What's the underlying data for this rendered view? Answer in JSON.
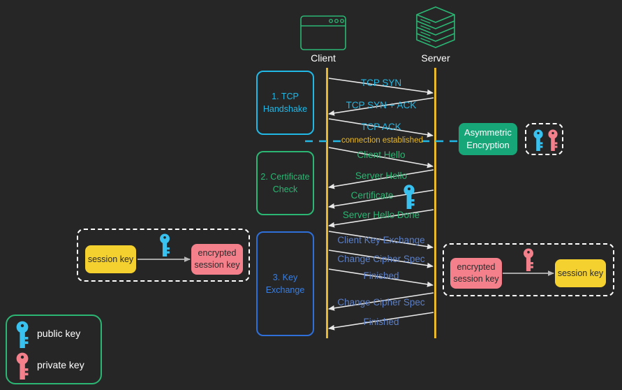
{
  "diagram": {
    "title": "TLS / SSL Handshake Sequence Diagram",
    "background_color": "#262626"
  },
  "actors": [
    {
      "name": "client",
      "label": "Client",
      "icon": "browser-window-icon"
    },
    {
      "name": "server",
      "label": "Server",
      "icon": "server-stack-icon"
    }
  ],
  "stages": [
    {
      "id": "stage-1",
      "label": "1. TCP\nHandshake",
      "line1": "1. TCP",
      "line2": "Handshake",
      "color": "#22B8E6"
    },
    {
      "id": "stage-2",
      "label": "2. Certificate\nCheck",
      "line1": "2. Certificate",
      "line2": "Check",
      "color": "#2BB673"
    },
    {
      "id": "stage-3",
      "label": "3. Key\nExchange",
      "line1": "3. Key",
      "line2": "Exchange",
      "color": "#3B7FE0"
    }
  ],
  "messages": [
    {
      "label": "TCP SYN",
      "direction": "client-to-server",
      "color": "#22B8E6"
    },
    {
      "label": "TCP SYN + ACK",
      "direction": "server-to-client",
      "color": "#22B8E6"
    },
    {
      "label": "TCP ACK",
      "direction": "client-to-server",
      "color": "#22B8E6"
    },
    {
      "label": "Client Hello",
      "direction": "client-to-server",
      "color": "#2BB673"
    },
    {
      "label": "Server Hello",
      "direction": "server-to-client",
      "color": "#2BB673"
    },
    {
      "label": "Certificate",
      "direction": "server-to-client",
      "color": "#2BB673",
      "badge": "public-key-icon"
    },
    {
      "label": "Server Hello Done",
      "direction": "server-to-client",
      "color": "#2BB673"
    },
    {
      "label": "Client Key Exchange",
      "direction": "client-to-server",
      "color": "#5B7FC7"
    },
    {
      "label": "Change Cipher Spec",
      "direction": "client-to-server",
      "color": "#5B7FC7"
    },
    {
      "label": "Finished",
      "direction": "client-to-server",
      "color": "#5B7FC7"
    },
    {
      "label": "Change Cipher Spec",
      "direction": "server-to-client",
      "color": "#5B7FC7"
    },
    {
      "label": "Finished",
      "direction": "server-to-client",
      "color": "#5B7FC7"
    }
  ],
  "separator": {
    "label": "connection established",
    "line_color": "#22B8E6",
    "text_color": "#E8B92C",
    "style": "dashed"
  },
  "asymmetric": {
    "label": "Asymmetric\nEncryption",
    "line1": "Asymmetric",
    "line2": "Encryption",
    "color": "#17A678",
    "keys": [
      "public-key-icon",
      "private-key-icon"
    ]
  },
  "client_encrypt_panel": {
    "from_label": "session key",
    "to_label": "encrypted\nsession key",
    "to_line1": "encrypted",
    "to_line2": "session key",
    "key": "public-key-icon"
  },
  "server_decrypt_panel": {
    "from_label": "encrypted\nsession key",
    "from_line1": "encrypted",
    "from_line2": "session key",
    "to_label": "session key",
    "key": "private-key-icon"
  },
  "legend": {
    "items": [
      {
        "icon": "public-key-icon",
        "label": "public key",
        "color": "#39C2F0"
      },
      {
        "icon": "private-key-icon",
        "label": "private key",
        "color": "#F4808C"
      }
    ]
  },
  "palette": {
    "background": "#262626",
    "lifeline": "#E8B92C",
    "arrow": "#E8E8E8",
    "cyan": "#22B8E6",
    "green": "#2BB673",
    "blue": "#5B7FC7",
    "gold": "#E8B92C",
    "yellow": "#F5D130",
    "pink": "#F4808C",
    "public_key": "#39C2F0",
    "private_key": "#F4808C",
    "white": "#ffffff"
  }
}
